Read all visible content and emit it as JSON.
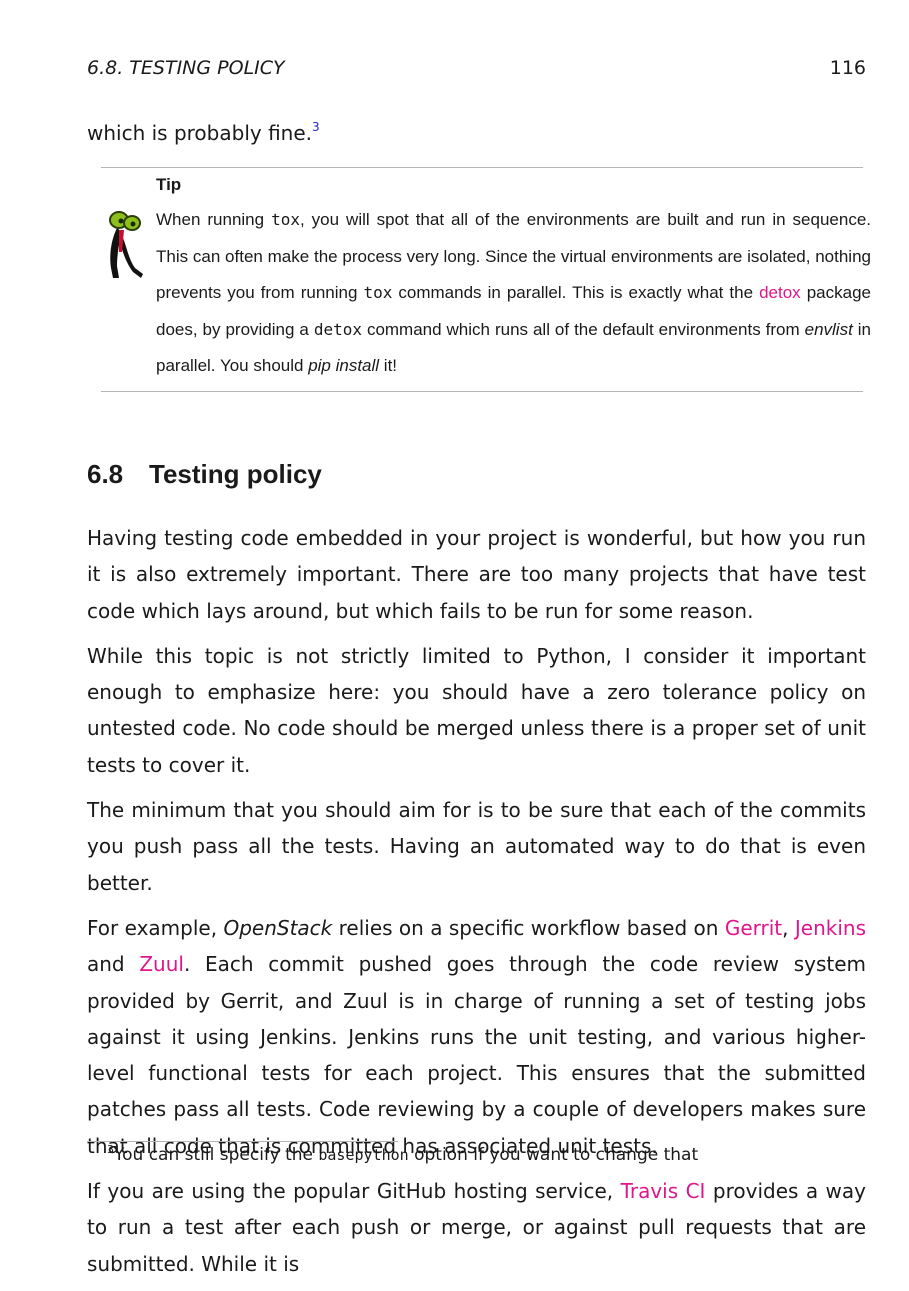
{
  "header": {
    "section": "6.8.  TESTING POLICY",
    "page_number": "116"
  },
  "lead": {
    "text": "which is probably fine.",
    "footnote_mark": "3"
  },
  "tip": {
    "figure_icon": "tip-mascot-icon",
    "title": "Tip",
    "p1": "When running ",
    "c1": "tox",
    "p2": ", you will spot that all of the environments are built and run in sequence. This can often make the process very long.  Since the virtual environments are isolated, nothing prevents you from running ",
    "c2": "tox",
    "p3": " commands in parallel.  This is exactly what the ",
    "link": "detox",
    "p4": " package does, by providing a ",
    "c3": "detox",
    "p5": " command which runs all of the default environments from ",
    "em1": "envlist",
    "p6": " in parallel. You should ",
    "em2": "pip install",
    "p7": " it!"
  },
  "section_heading": {
    "number": "6.8",
    "title": "Testing policy"
  },
  "paragraphs": {
    "p1": "Having testing code embedded in your project is wonderful, but how you run it is also extremely important.  There are too many projects that have test code which lays around, but which fails to be run for some reason.",
    "p2": "While this topic is not strictly limited to Python, I consider it important enough to emphasize here: you should have a zero tolerance policy on untested code. No code should be merged unless there is a proper set of unit tests to cover it.",
    "p3": "The minimum that you should aim for is to be sure that each of the commits you push pass all the tests. Having an automated way to do that is even better.",
    "p4": {
      "a": "For example, ",
      "em": "OpenStack",
      "b": " relies on a specific workflow based on ",
      "link1": "Gerrit",
      "c": ", ",
      "link2": "Jenkins",
      "d": " and ",
      "link3": "Zuul",
      "e": ". Each commit pushed goes through the code review system provided by Gerrit, and Zuul is in charge of running a set of testing jobs against it using Jenkins.  Jenkins runs the unit testing, and various higher-level functional tests for each project.  This ensures that the submitted patches pass all tests.  Code reviewing by a couple of developers makes sure that all code that is committed has associated unit tests."
    },
    "p5": {
      "a": "If you are using the popular GitHub hosting service, ",
      "link": "Travis CI",
      "b": " provides a way to run a test after each push or merge, or against pull requests that are submitted. While it is"
    }
  },
  "footnote": {
    "mark": "3",
    "a": "You can still specify the ",
    "code": "basepython",
    "b": " option if you want to change that"
  },
  "colors": {
    "link": "#e0168c",
    "footnote_mark": "#2323d8",
    "rule": "#b4b4b4"
  }
}
